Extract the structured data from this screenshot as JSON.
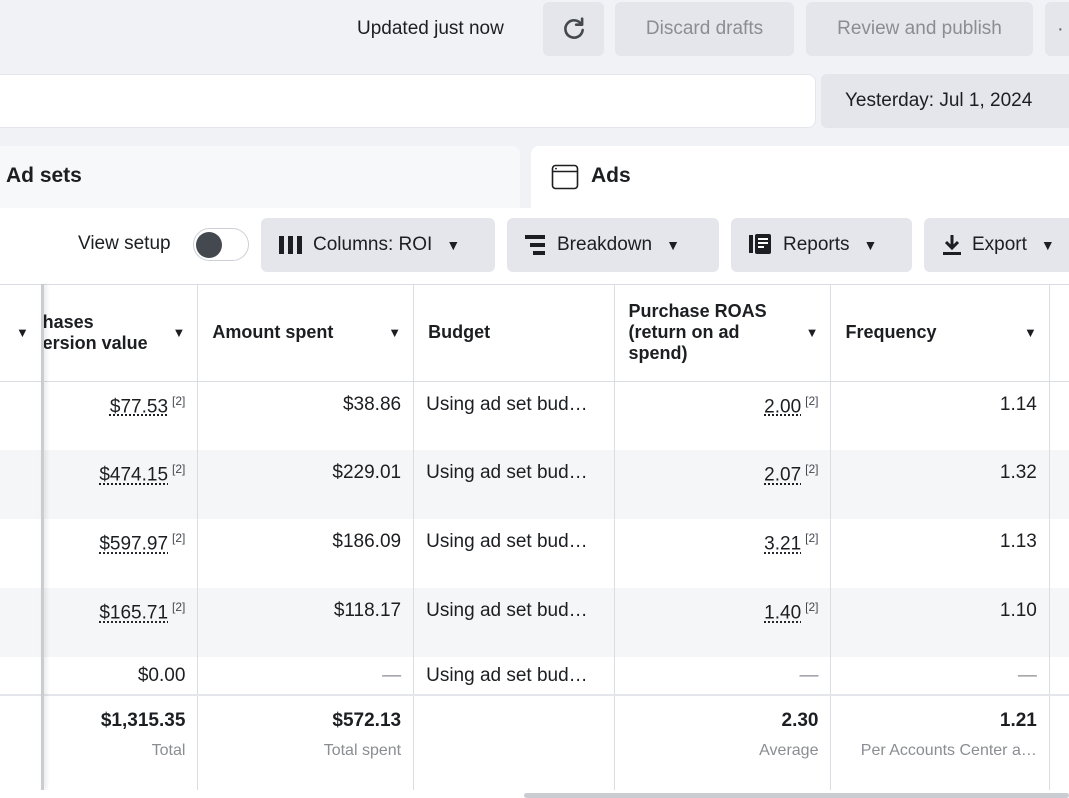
{
  "topbar": {
    "updated_text": "Updated just now",
    "discard_label": "Discard drafts",
    "publish_label": "Review and publish"
  },
  "date_range": "Yesterday: Jul 1, 2024",
  "tabs": {
    "adsets_label": "Ad sets",
    "ads_label": "Ads"
  },
  "toolbar": {
    "view_setup_label": "View setup",
    "columns_label": "Columns: ROI",
    "breakdown_label": "Breakdown",
    "reports_label": "Reports",
    "export_label": "Export"
  },
  "table": {
    "headers": {
      "purchases_value_line1": "hases",
      "purchases_value_line2": "ersion value",
      "amount_spent": "Amount spent",
      "budget": "Budget",
      "roas_line1": "Purchase ROAS",
      "roas_line2": "(return on ad",
      "roas_line3": "spend)",
      "frequency": "Frequency"
    },
    "footnote": "[2]",
    "rows": [
      {
        "value": "$77.53",
        "spent": "$38.86",
        "budget": "Using ad set bud…",
        "roas": "2.00",
        "frequency": "1.14"
      },
      {
        "value": "$474.15",
        "spent": "$229.01",
        "budget": "Using ad set bud…",
        "roas": "2.07",
        "frequency": "1.32"
      },
      {
        "value": "$597.97",
        "spent": "$186.09",
        "budget": "Using ad set bud…",
        "roas": "3.21",
        "frequency": "1.13"
      },
      {
        "value": "$165.71",
        "spent": "$118.17",
        "budget": "Using ad set bud…",
        "roas": "1.40",
        "frequency": "1.10"
      }
    ],
    "partial_row": {
      "value": "$0.00",
      "spent": "—",
      "budget": "Using ad set bud…",
      "roas": "—",
      "frequency": "—"
    },
    "totals": {
      "value": "$1,315.35",
      "value_label": "Total",
      "spent": "$572.13",
      "spent_label": "Total spent",
      "roas": "2.30",
      "roas_label": "Average",
      "frequency": "1.21",
      "frequency_label": "Per Accounts Center a…"
    }
  }
}
